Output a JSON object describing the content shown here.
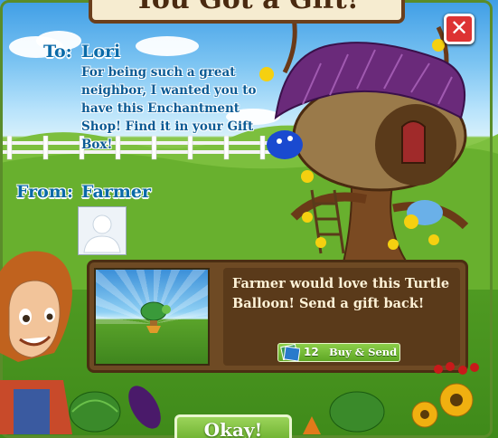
{
  "dialog": {
    "title": "You Got a Gift!",
    "close_label": "✕"
  },
  "to": {
    "label": "To:",
    "name": "Lori",
    "message": "For being such a great neighbor, I wanted you to have this Enchantment Shop! Find it in your Gift Box!"
  },
  "from": {
    "label": "From:",
    "name": "Farmer"
  },
  "send_back": {
    "text": "Farmer would love this Turtle Balloon!  Send a gift back!",
    "cost": "12",
    "button_label": "Buy & Send"
  },
  "okay_label": "Okay!",
  "colors": {
    "label_blue": "#0a6aa8",
    "panel_brown": "#6e4a24",
    "button_green": "#6aae2c",
    "close_red": "#dd3333",
    "roof_purple": "#6a2a7a"
  },
  "icons": [
    "close-icon",
    "avatar-placeholder-icon",
    "farm-cash-icon"
  ]
}
